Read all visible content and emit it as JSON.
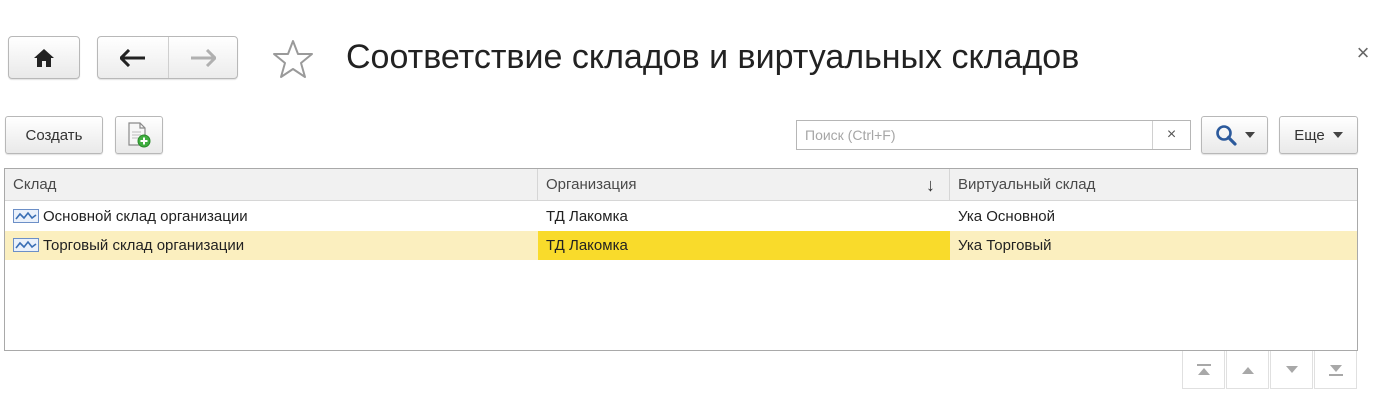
{
  "window": {
    "title": "Соответствие складов и виртуальных складов",
    "close_glyph": "×"
  },
  "toolbar": {
    "create_label": "Создать",
    "more_label": "Еще"
  },
  "search": {
    "placeholder": "Поиск (Ctrl+F)",
    "value": "",
    "clear_glyph": "×"
  },
  "table": {
    "columns": [
      {
        "label": "Склад"
      },
      {
        "label": "Организация",
        "sort": "↓"
      },
      {
        "label": "Виртуальный склад"
      }
    ],
    "rows": [
      {
        "warehouse": "Основной склад организации",
        "organization": "ТД Лакомка",
        "virtual_warehouse": "Ука Основной",
        "selected": false
      },
      {
        "warehouse": "Торговый склад организации",
        "organization": "ТД Лакомка",
        "virtual_warehouse": "Ука Торговый",
        "selected": true
      }
    ]
  },
  "colors": {
    "selected_row": "#fbefbf",
    "active_cell": "#f9db2b",
    "header_bg": "#f1f1f1",
    "icon_blue": "#3a6fb5"
  },
  "icons": [
    "home-icon",
    "back-arrow-icon",
    "forward-arrow-icon",
    "star-icon",
    "close-icon",
    "add-document-icon",
    "search-icon",
    "chevron-down-icon",
    "warehouse-icon",
    "sort-down-icon",
    "go-first-icon",
    "go-previous-icon",
    "go-next-icon",
    "go-last-icon"
  ]
}
